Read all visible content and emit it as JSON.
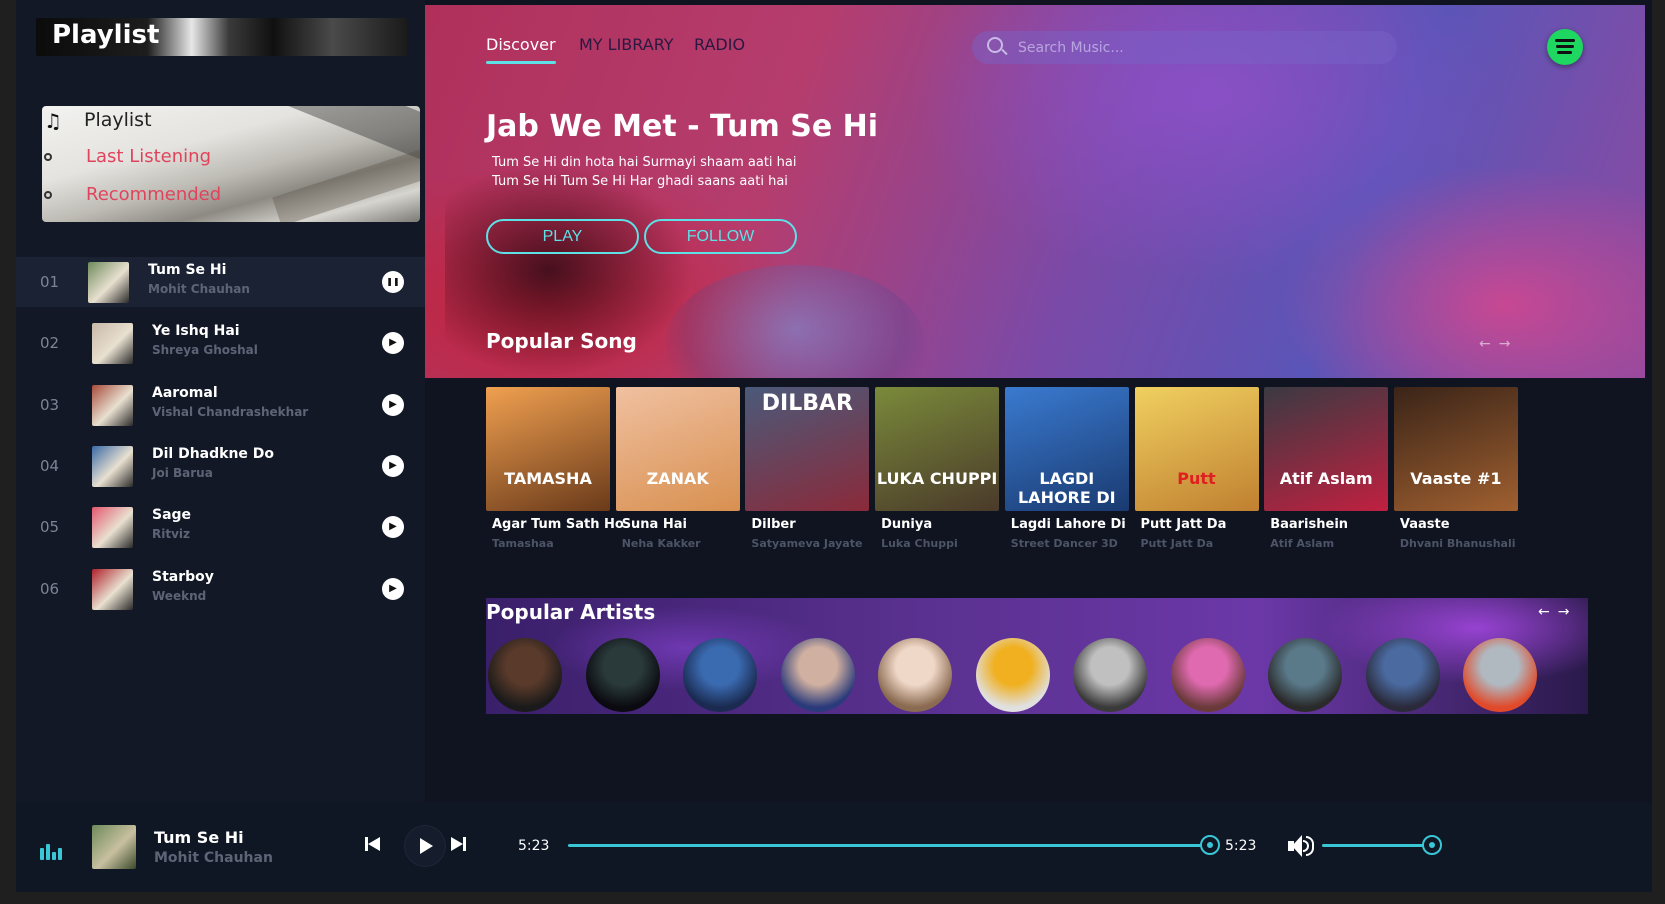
{
  "sidebar": {
    "brand_title": "Playlist",
    "menu": {
      "title": "Playlist",
      "items": [
        "Last Listening",
        "Recommended"
      ]
    },
    "tracks": [
      {
        "num": "01",
        "title": "Tum Se Hi",
        "artist": "Mohit Chauhan",
        "state": "pause",
        "thumb": "#6d8a5a"
      },
      {
        "num": "02",
        "title": "Ye Ishq Hai",
        "artist": "Shreya Ghoshal",
        "state": "play",
        "thumb": "#c8b8a8"
      },
      {
        "num": "03",
        "title": "Aaromal",
        "artist": "Vishal Chandrashekhar",
        "state": "play",
        "thumb": "#a64a3a"
      },
      {
        "num": "04",
        "title": "Dil Dhadkne Do",
        "artist": "Joi Barua",
        "state": "play",
        "thumb": "#3a6aa6"
      },
      {
        "num": "05",
        "title": "Sage",
        "artist": "Ritviz",
        "state": "play",
        "thumb": "#e4576e"
      },
      {
        "num": "06",
        "title": "Starboy",
        "artist": "Weeknd",
        "state": "play",
        "thumb": "#b0202a"
      }
    ]
  },
  "nav": {
    "items": [
      "Discover",
      "MY LIBRARY",
      "RADIO"
    ],
    "active": "Discover"
  },
  "search": {
    "placeholder": "Search Music..."
  },
  "hero": {
    "title": "Jab We Met - Tum Se Hi",
    "lyrics": [
      "Tum Se Hi din hota hai Surmayi shaam aati hai",
      "Tum Se Hi Tum Se Hi Har ghadi saans aati hai"
    ],
    "play_label": "PLAY",
    "follow_label": "FOLLOW"
  },
  "popular_songs": {
    "heading": "Popular Song",
    "items": [
      {
        "title": "Agar Tum Sath Ho",
        "sub": "Tamashaa",
        "cover_text": "TAMASHA",
        "c1": "#f0a050",
        "c2": "#6a3a1a"
      },
      {
        "title": "Suna Hai",
        "sub": "Neha Kakker",
        "cover_text": "ZANAK",
        "c1": "#f0c0a0",
        "c2": "#d89050"
      },
      {
        "title": "Dilber",
        "sub": "Satyameva Jayate",
        "cover_text": "DILBAR",
        "c1": "#4a5a7a",
        "c2": "#8a2a3a"
      },
      {
        "title": "Duniya",
        "sub": "Luka Chuppi",
        "cover_text": "LUKA CHUPPI",
        "c1": "#7a8a3a",
        "c2": "#4a3a2a"
      },
      {
        "title": "Lagdi Lahore Di",
        "sub": "Street Dancer 3D",
        "cover_text": "LAGDI LAHORE DI",
        "c1": "#3a7ad0",
        "c2": "#1a3a70"
      },
      {
        "title": "Putt Jatt Da",
        "sub": "Putt Jatt Da",
        "cover_text": "Putt",
        "c1": "#f0d060",
        "c2": "#c08030"
      },
      {
        "title": "Baarishein",
        "sub": "Atif Aslam",
        "cover_text": "Atif Aslam",
        "c1": "#3a3a42",
        "c2": "#c02040"
      },
      {
        "title": "Vaaste",
        "sub": "Dhvani Bhanushali",
        "cover_text": "Vaaste #1",
        "c1": "#3a2418",
        "c2": "#a06030"
      }
    ]
  },
  "popular_artists": {
    "heading": "Popular Artists",
    "items": [
      {
        "c1": "#5a3a2a",
        "c2": "#1a1a1a"
      },
      {
        "c1": "#2a3a3a",
        "c2": "#0a0a10"
      },
      {
        "c1": "#3a6ab0",
        "c2": "#1a2a50"
      },
      {
        "c1": "#d0b0a0",
        "c2": "#2a3a7a"
      },
      {
        "c1": "#f0d8c8",
        "c2": "#8a6a50"
      },
      {
        "c1": "#f0b020",
        "c2": "#e0e0e0"
      },
      {
        "c1": "#c0c0c0",
        "c2": "#3a3a3a"
      },
      {
        "c1": "#e06ab0",
        "c2": "#6a3a3a"
      },
      {
        "c1": "#5a7a8a",
        "c2": "#2a2a2a"
      },
      {
        "c1": "#4a6aa0",
        "c2": "#2a2a3a"
      },
      {
        "c1": "#b0b8c0",
        "c2": "#e04a2a"
      }
    ]
  },
  "player": {
    "title": "Tum Se Hi",
    "artist": "Mohit Chauhan",
    "elapsed": "5:23",
    "duration": "5:23",
    "progress": 1.0,
    "volume": 1.0,
    "accent": "#39c7d6"
  }
}
